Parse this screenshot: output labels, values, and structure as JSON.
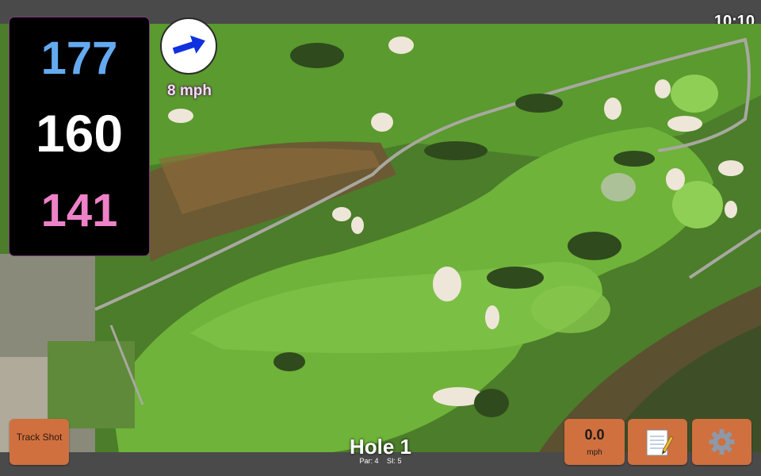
{
  "status": {
    "time": "10:10"
  },
  "distances": {
    "back": "177",
    "middle": "160",
    "front": "141"
  },
  "wind": {
    "speed_label": "8 mph",
    "icon": "wind-direction-arrow-icon",
    "colors": {
      "arrow": "#1030e0"
    }
  },
  "buttons": {
    "track_shot_label": "Track Shot",
    "speed_value": "0.0",
    "speed_unit": "mph",
    "notes_icon": "notepad-icon",
    "settings_icon": "gear-icon"
  },
  "hole": {
    "title": "Hole 1",
    "par_label": "Par: 4",
    "si_label": "SI: 5"
  },
  "colors": {
    "button_bg": "#d0703f",
    "panel_bg": "#000000",
    "back_distance": "#64aaf0",
    "middle_distance": "#ffffff",
    "front_distance": "#ee82c8"
  }
}
